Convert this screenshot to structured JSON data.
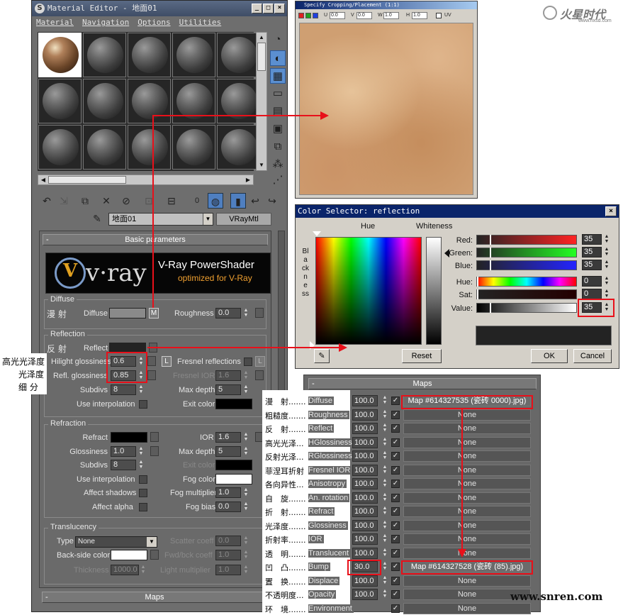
{
  "material_editor": {
    "title": "Material Editor - 地面01",
    "menu": [
      "Material",
      "Navigation",
      "Options",
      "Utilities"
    ],
    "toolbar_value": "0",
    "material_name": "地面01",
    "material_type": "VRayMtl",
    "basic_params_title": "Basic parameters",
    "banner": {
      "brand": "v·ray",
      "line1": "V-Ray PowerShader",
      "line2": "optimized for V-Ray"
    },
    "diffuse": {
      "group": "Diffuse",
      "cn": "漫 射",
      "label": "Diffuse",
      "map_btn": "M",
      "roughness_label": "Roughness",
      "roughness": "0.0"
    },
    "reflection": {
      "group": "Reflection",
      "cn": "反 射",
      "reflect_label": "Reflect",
      "hilight_label": "Hilight glossiness",
      "hilight": "0.6",
      "lock": "L",
      "refl_label": "Refl. glossiness",
      "refl": "0.85",
      "subdivs_label": "Subdivs",
      "subdivs": "8",
      "interp_label": "Use interpolation",
      "fresnel_label": "Fresnel reflections",
      "fresnel_lock": "L",
      "fresnel_ior_label": "Fresnel IOR",
      "fresnel_ior": "1.6",
      "max_depth_label": "Max depth",
      "max_depth": "5",
      "exit_label": "Exit color"
    },
    "refraction": {
      "group": "Refraction",
      "refract_label": "Refract",
      "ior_label": "IOR",
      "ior": "1.6",
      "gloss_label": "Glossiness",
      "gloss": "1.0",
      "max_depth_label": "Max depth",
      "max_depth": "5",
      "subdivs_label": "Subdivs",
      "subdivs": "8",
      "exit_label": "Exit color",
      "interp_label": "Use interpolation",
      "fog_color_label": "Fog color",
      "shadows_label": "Affect shadows",
      "fog_mult_label": "Fog multiplier",
      "fog_mult": "1.0",
      "alpha_label": "Affect alpha",
      "fog_bias_label": "Fog bias",
      "fog_bias": "0.0"
    },
    "translucency": {
      "group": "Translucency",
      "type_label": "Type",
      "type": "None",
      "scatter_label": "Scatter coeff",
      "scatter": "0.0",
      "backside_label": "Back-side color",
      "fwd_label": "Fwd/bck coeff",
      "fwd": "1.0",
      "thickness_label": "Thickness",
      "thickness": "1000.0",
      "light_label": "Light multiplier",
      "light": "1.0"
    },
    "maps_title": "Maps"
  },
  "annotations": {
    "hilight": "高光光泽度",
    "refl": "光泽度",
    "subdivs": "细 分"
  },
  "crop_window": {
    "title": "Specify Cropping/Placement (1:1)",
    "u": "U",
    "u_val": "0.0",
    "v": "V",
    "v_val": "0.0",
    "w": "W",
    "w_val": "1.0",
    "h": "H",
    "h_val": "1.0",
    "uv": "UV"
  },
  "color_selector": {
    "title": "Color Selector: reflection",
    "hue_label": "Hue",
    "whiteness_label": "Whiteness",
    "blackness_label": "Blackness",
    "rows": [
      {
        "label": "Red:",
        "value": "35"
      },
      {
        "label": "Green:",
        "value": "35"
      },
      {
        "label": "Blue:",
        "value": "35"
      },
      {
        "label": "Hue:",
        "value": "0"
      },
      {
        "label": "Sat:",
        "value": "0"
      },
      {
        "label": "Value:",
        "value": "35"
      }
    ],
    "reset": "Reset",
    "ok": "OK",
    "cancel": "Cancel",
    "color": "#232323"
  },
  "maps_panel": {
    "title": "Maps",
    "rows": [
      {
        "cn": "漫　射.......",
        "name": "Diffuse",
        "amount": "100.0",
        "map": "Map #614327535 (瓷砖 0000).jpg)"
      },
      {
        "cn": "粗糙度.......",
        "name": "Roughness",
        "amount": "100.0",
        "map": "None"
      },
      {
        "cn": "反　射.......",
        "name": "Reflect",
        "amount": "100.0",
        "map": "None"
      },
      {
        "cn": "高光光泽...",
        "name": "HGlossiness",
        "amount": "100.0",
        "map": "None"
      },
      {
        "cn": "反射光泽...",
        "name": "RGlossiness",
        "amount": "100.0",
        "map": "None"
      },
      {
        "cn": "菲涅耳折射",
        "name": "Fresnel IOR",
        "amount": "100.0",
        "map": "None"
      },
      {
        "cn": "各向异性...",
        "name": "Anisotropy",
        "amount": "100.0",
        "map": "None"
      },
      {
        "cn": "自　旋.......",
        "name": "An. rotation",
        "amount": "100.0",
        "map": "None"
      },
      {
        "cn": "折　射.......",
        "name": "Refract",
        "amount": "100.0",
        "map": "None"
      },
      {
        "cn": "光泽度.......",
        "name": "Glossiness",
        "amount": "100.0",
        "map": "None"
      },
      {
        "cn": "折射率.......",
        "name": "IOR",
        "amount": "100.0",
        "map": "None"
      },
      {
        "cn": "透　明.......",
        "name": "Translucent",
        "amount": "100.0",
        "map": "None"
      },
      {
        "cn": "凹　凸.......",
        "name": "Bump",
        "amount": "30.0",
        "map": "Map #614327528 (瓷砖 (85).jpg)"
      },
      {
        "cn": "置　换.......",
        "name": "Displace",
        "amount": "100.0",
        "map": "None"
      },
      {
        "cn": "不透明度...",
        "name": "Opacity",
        "amount": "100.0",
        "map": "None"
      },
      {
        "cn": "环　境.......",
        "name": "Environment",
        "amount": "",
        "map": "None"
      }
    ]
  },
  "watermark": {
    "logo": "火星时代",
    "url": "www.hxsd.com",
    "footer": "www.snren.com"
  }
}
